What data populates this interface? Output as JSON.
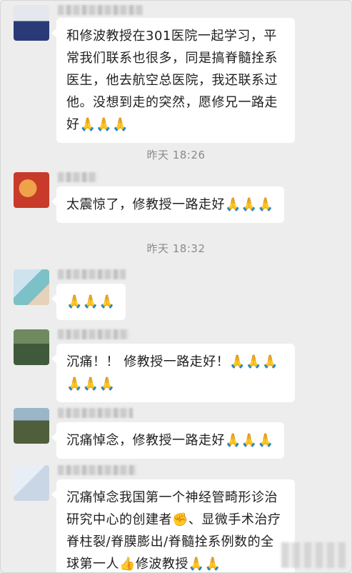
{
  "messages": [
    {
      "text": "和修波教授在301医院一起学习，平常我们联系也很多，同是搞脊髓拴系医生，他去航空总医院，我还联系过他。没想到走的突然，愿修兄一路走好🙏🙏🙏"
    },
    {
      "text": "太震惊了，修教授一路走好🙏🙏🙏"
    },
    {
      "text": "🙏🙏🙏"
    },
    {
      "text": "沉痛！！ 修教授一路走好！🙏🙏🙏🙏🙏🙏"
    },
    {
      "text": "沉痛悼念，修教授一路走好🙏🙏🙏"
    },
    {
      "text": "沉痛悼念我国第一个神经管畸形诊治研究中心的创建者✊、显微手术治疗脊柱裂/脊膜膨出/脊髓拴系例数的全球第一人👍修波教授🙏🙏"
    }
  ],
  "timestamps": [
    "昨天 18:26",
    "昨天 18:32"
  ],
  "colors": {
    "background": "#ededed",
    "bubble": "#ffffff",
    "text": "#1f1f1f",
    "timestamp": "#8a8a8a"
  }
}
